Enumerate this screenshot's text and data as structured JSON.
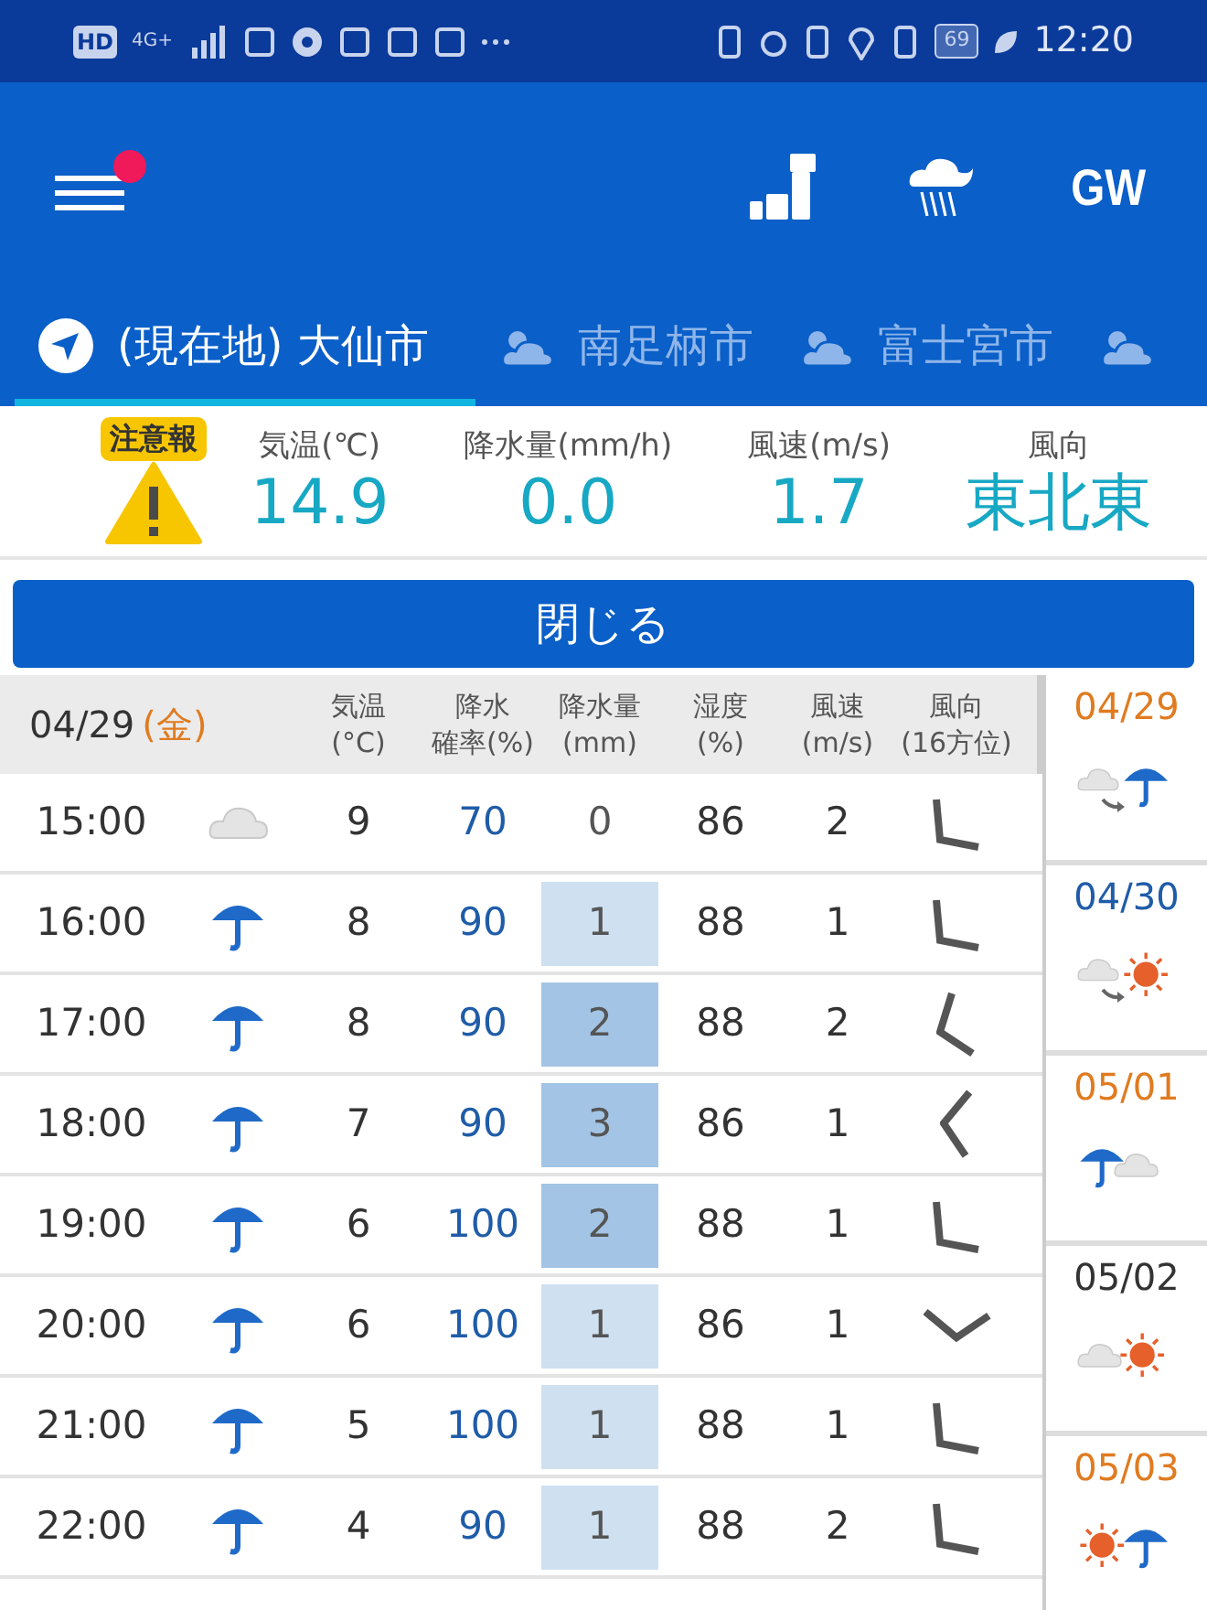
{
  "status_bar": {
    "left_labels": [
      "HD",
      "4G+"
    ],
    "battery": "69",
    "time": "12:20"
  },
  "header": {
    "notification": true,
    "gw_label": "GW"
  },
  "tabs": [
    {
      "label": "(現在地) 大仙市",
      "kind": "location",
      "selected": true
    },
    {
      "label": "南足柄市",
      "kind": "weather",
      "selected": false
    },
    {
      "label": "富士宮市",
      "kind": "weather",
      "selected": false
    },
    {
      "kind": "weather",
      "selected": false
    }
  ],
  "current": {
    "warning": "注意報",
    "readings": [
      {
        "label": "気温(℃)",
        "value": "14.9"
      },
      {
        "label": "降水量(mm/h)",
        "value": "0.0"
      },
      {
        "label": "風速(m/s)",
        "value": "1.7"
      },
      {
        "label": "風向",
        "value": "東北東"
      }
    ]
  },
  "close_button": "閉じる",
  "table": {
    "date": "04/29",
    "weekday": "(金)",
    "columns": [
      {
        "line1": "気温",
        "line2": "(°C)"
      },
      {
        "line1": "降水",
        "line2": "確率(%)"
      },
      {
        "line1": "降水量",
        "line2": "(mm)"
      },
      {
        "line1": "湿度",
        "line2": "(%)"
      },
      {
        "line1": "風速",
        "line2": "(m/s)"
      },
      {
        "line1": "風向",
        "line2": "(16方位)"
      }
    ],
    "rows": [
      {
        "time": "15:00",
        "kind": "cloud",
        "temp": "9",
        "prob": "70",
        "rain": {
          "value": "0",
          "color": "#ffffff"
        },
        "humidity": "86",
        "wind": "2",
        "wind_dir": {
          "kind": "ne"
        }
      },
      {
        "time": "16:00",
        "kind": "rain",
        "temp": "8",
        "prob": "90",
        "rain": {
          "value": "1",
          "color": "#cfe0f0"
        },
        "humidity": "88",
        "wind": "1",
        "wind_dir": {
          "kind": "ne"
        }
      },
      {
        "time": "17:00",
        "kind": "rain",
        "temp": "8",
        "prob": "90",
        "rain": {
          "value": "2",
          "color": "#a3c4e4"
        },
        "humidity": "88",
        "wind": "2",
        "wind_dir": {
          "kind": "ene"
        }
      },
      {
        "time": "18:00",
        "kind": "rain",
        "temp": "7",
        "prob": "90",
        "rain": {
          "value": "3",
          "color": "#a3c4e4"
        },
        "humidity": "86",
        "wind": "1",
        "wind_dir": {
          "kind": "e"
        }
      },
      {
        "time": "19:00",
        "kind": "rain",
        "temp": "6",
        "prob": "100",
        "rain": {
          "value": "2",
          "color": "#a3c4e4"
        },
        "humidity": "88",
        "wind": "1",
        "wind_dir": {
          "kind": "ne"
        }
      },
      {
        "time": "20:00",
        "kind": "rain",
        "temp": "6",
        "prob": "100",
        "rain": {
          "value": "1",
          "color": "#cfe0f0"
        },
        "humidity": "86",
        "wind": "1",
        "wind_dir": {
          "kind": "n"
        }
      },
      {
        "time": "21:00",
        "kind": "rain",
        "temp": "5",
        "prob": "100",
        "rain": {
          "value": "1",
          "color": "#cfe0f0"
        },
        "humidity": "88",
        "wind": "1",
        "wind_dir": {
          "kind": "ne"
        }
      },
      {
        "time": "22:00",
        "kind": "rain",
        "temp": "4",
        "prob": "90",
        "rain": {
          "value": "1",
          "color": "#cfe0f0"
        },
        "humidity": "88",
        "wind": "2",
        "wind_dir": {
          "kind": "ne"
        }
      }
    ]
  },
  "days": [
    {
      "date": "04/29",
      "color": "#e07b20",
      "kind": "cloud-to-rain"
    },
    {
      "date": "04/30",
      "color": "#1f5ca8",
      "kind": "cloud-to-sun"
    },
    {
      "date": "05/01",
      "color": "#e07b20",
      "kind": "rain-cloud"
    },
    {
      "date": "05/02",
      "color": "#333333",
      "kind": "cloud-sun"
    },
    {
      "date": "05/03",
      "color": "#e07b20",
      "kind": "sun-rain"
    }
  ]
}
